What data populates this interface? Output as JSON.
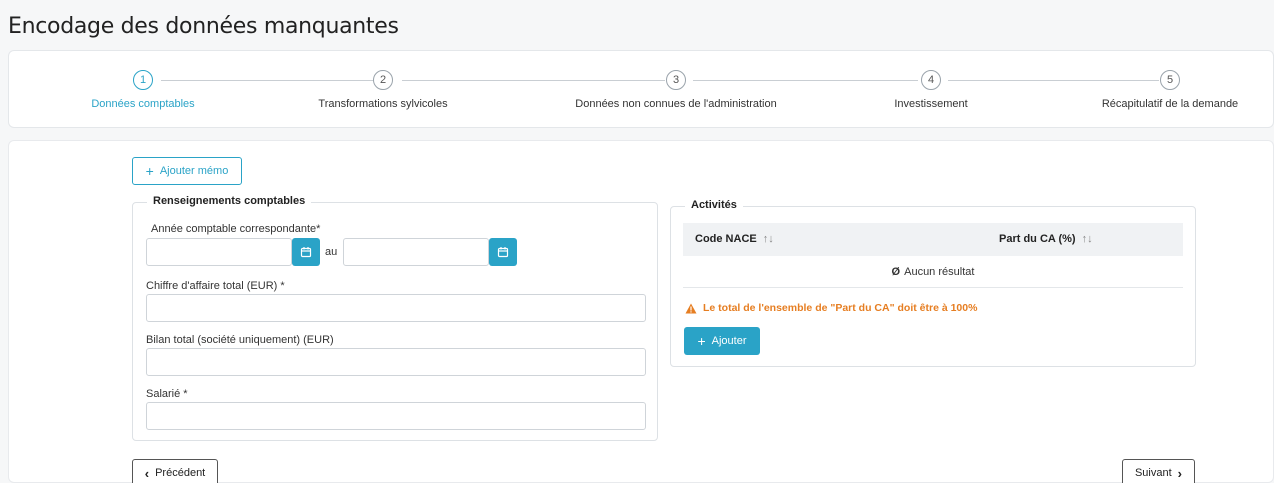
{
  "page": {
    "title": "Encodage des données manquantes"
  },
  "stepper": {
    "steps": [
      {
        "number": "1",
        "label": "Données comptables",
        "active": true
      },
      {
        "number": "2",
        "label": "Transformations sylvicoles",
        "active": false
      },
      {
        "number": "3",
        "label": "Données non connues de l'administration",
        "active": false
      },
      {
        "number": "4",
        "label": "Investissement",
        "active": false
      },
      {
        "number": "5",
        "label": "Récapitulatif de la demande",
        "active": false
      }
    ]
  },
  "memo": {
    "add_label": "Ajouter mémo",
    "icon": "plus-icon"
  },
  "accounting": {
    "legend": "Renseignements comptables",
    "year_label": "Année comptable correspondante*",
    "year_from_value": "",
    "year_between_label": "au",
    "year_to_value": "",
    "turnover_label": "Chiffre d'affaire total (EUR) *",
    "turnover_value": "",
    "balance_label": "Bilan total (société uniquement) (EUR)",
    "balance_value": "",
    "employees_label": "Salarié *",
    "employees_value": ""
  },
  "activities": {
    "legend": "Activités",
    "columns": [
      "Code NACE",
      "Part du CA (%)"
    ],
    "sort_icon": "↑↓",
    "empty_icon": "Ø",
    "empty_text": "Aucun résultat",
    "warning_text": "Le total de l'ensemble de \"Part du CA\" doit être à 100%",
    "add_label": "Ajouter"
  },
  "nav": {
    "prev_label": "Précédent",
    "next_label": "Suivant"
  },
  "colors": {
    "accent": "#2aa3c7",
    "warning": "#e67e22"
  }
}
